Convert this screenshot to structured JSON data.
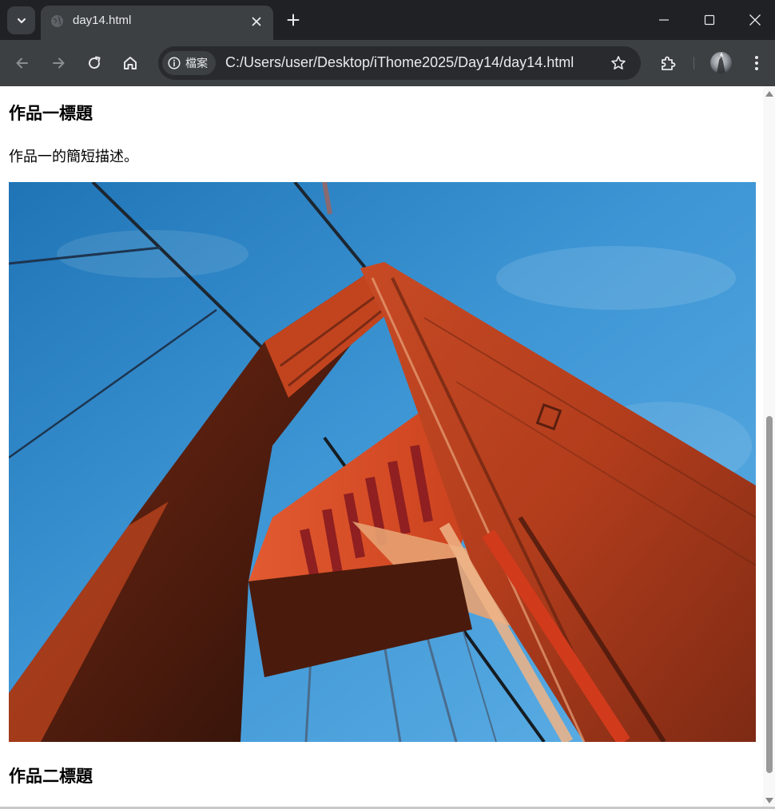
{
  "window": {
    "controls": [
      "minimize-icon",
      "maximize-icon",
      "close-icon"
    ]
  },
  "tabs": [
    {
      "title": "day14.html",
      "active": true,
      "favicon": "globe-icon"
    }
  ],
  "toolbar": {
    "back_icon": "back-arrow-icon",
    "forward_icon": "forward-arrow-icon",
    "reload_icon": "reload-icon",
    "home_icon": "home-icon",
    "site_info_label": "檔案",
    "url": "C:/Users/user/Desktop/iThome2025/Day14/day14.html",
    "bookmark_icon": "star-icon",
    "extensions_icon": "puzzle-icon",
    "menu_icon": "kebab-menu-icon"
  },
  "page": {
    "works": [
      {
        "title": "作品一標題",
        "description": "作品一的簡短描述。",
        "image": "Golden Gate Bridge tower photograph"
      },
      {
        "title": "作品二標題"
      }
    ]
  },
  "colors": {
    "tabstrip_bg": "#202124",
    "toolbar_bg": "#3c4043",
    "omnibox_bg": "#282a2d",
    "text_light": "#e8eaed",
    "page_bg": "#ffffff"
  }
}
